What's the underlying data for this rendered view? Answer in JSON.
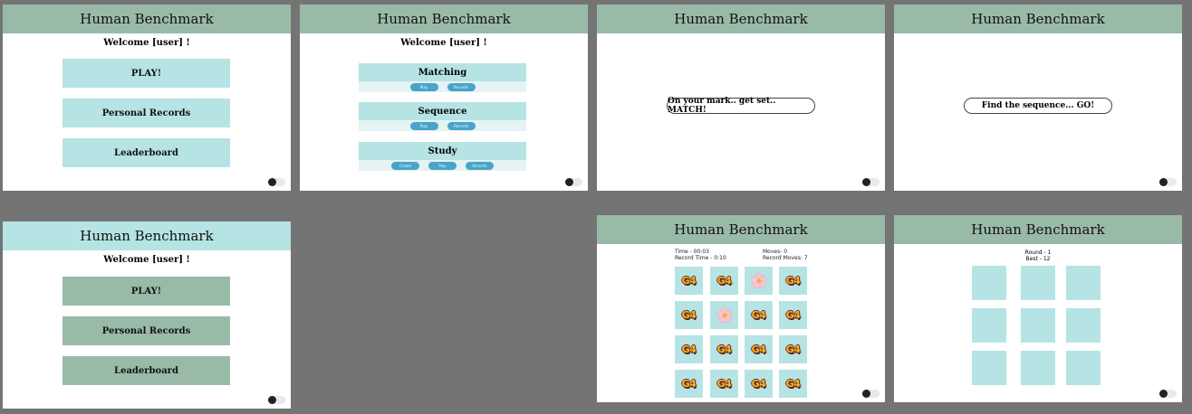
{
  "app_title": "Human Benchmark",
  "welcome": "Welcome [user] !",
  "menu": {
    "play": "PLAY!",
    "records": "Personal Records",
    "leaderboard": "Leaderboard"
  },
  "games": [
    {
      "title": "Matching",
      "buttons": [
        "Play",
        "Records"
      ]
    },
    {
      "title": "Sequence",
      "buttons": [
        "Play",
        "Records"
      ]
    },
    {
      "title": "Study",
      "buttons": [
        "Create",
        "Play",
        "Records"
      ]
    }
  ],
  "match_intro": "On your mark.. get set.. MATCH!",
  "sequence_intro": "Find the sequence... GO!",
  "match_stats": {
    "time": "Time - 00:03",
    "record_time": "Record Time - 0:10",
    "moves": "Moves- 0",
    "record_moves": "Record Moves: 7"
  },
  "card_face_text": "G4",
  "match_grid": [
    [
      "g4",
      "g4",
      "flower",
      "g4"
    ],
    [
      "g4",
      "flower",
      "g4",
      "g4"
    ],
    [
      "g4",
      "g4",
      "g4",
      "g4"
    ],
    [
      "g4",
      "g4",
      "g4",
      "g4"
    ]
  ],
  "sequence_stats": {
    "round": "Round - 1",
    "best": "Best - 12"
  },
  "colors": {
    "background": "#747474",
    "header_green": "#9abaa8",
    "light_teal": "#b6e3e4",
    "pill_blue": "#4aa3c8"
  }
}
